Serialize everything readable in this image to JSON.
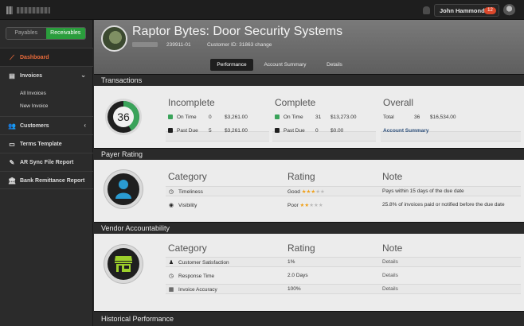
{
  "topbar": {
    "user_name": "John Hammond",
    "notification_count": "12"
  },
  "sidebar": {
    "toggle": {
      "payables": "Payables",
      "receivables": "Receivables"
    },
    "items": [
      {
        "label": "Dashboard",
        "icon": "chart-line-icon"
      },
      {
        "label": "Invoices",
        "icon": "invoice-icon"
      },
      {
        "label": "All Invoices"
      },
      {
        "label": "New Invoice"
      },
      {
        "label": "Customers",
        "icon": "users-icon"
      },
      {
        "label": "Terms Template",
        "icon": "document-icon"
      },
      {
        "label": "AR Sync File Report",
        "icon": "wrench-icon"
      },
      {
        "label": "Bank Remittance Report",
        "icon": "bank-icon"
      }
    ]
  },
  "header": {
    "title": "Raptor Bytes: Door Security Systems",
    "account_number": "239911-01",
    "customer_id_label": "Customer ID:",
    "customer_id": "31863",
    "change_link": "change"
  },
  "tabs": [
    "Performance",
    "Account Summary",
    "Details"
  ],
  "transactions": {
    "section_title": "Transactions",
    "circle_value": "36",
    "incomplete": {
      "heading": "Incomplete",
      "rows": [
        {
          "label": "On Time",
          "count": "0",
          "amount": "$3,261.00"
        },
        {
          "label": "Past Due",
          "count": "5",
          "amount": "$3,261.00"
        }
      ]
    },
    "complete": {
      "heading": "Complete",
      "rows": [
        {
          "label": "On Time",
          "count": "31",
          "amount": "$13,273.00"
        },
        {
          "label": "Past Due",
          "count": "0",
          "amount": "$0.00"
        }
      ]
    },
    "overall": {
      "heading": "Overall",
      "total_label": "Total",
      "total_count": "36",
      "total_amount": "$16,534.00",
      "link": "Account Summary"
    },
    "colors": {
      "on_time": "#3aa35a",
      "past_due": "#1f1f1f"
    }
  },
  "payer_rating": {
    "section_title": "Payer Rating",
    "headers": {
      "category": "Category",
      "rating": "Rating",
      "note": "Note"
    },
    "rows": [
      {
        "category": "Timeliness",
        "icon": "clock-icon",
        "rating": "Good",
        "stars": 3,
        "note": "Pays within 15 days of the due date"
      },
      {
        "category": "Visibility",
        "icon": "eye-icon",
        "rating": "Poor",
        "stars": 2,
        "note": "25.8% of invoices paid or notified before the due date"
      }
    ],
    "circle_color": "#2a9bd1"
  },
  "vendor_accountability": {
    "section_title": "Vendor Accountability",
    "headers": {
      "category": "Category",
      "rating": "Rating",
      "note": "Note"
    },
    "rows": [
      {
        "category": "Customer Satisfaction",
        "icon": "person-icon",
        "rating": "1%",
        "note": "Details"
      },
      {
        "category": "Response Time",
        "icon": "clock-icon",
        "rating": "2.0 Days",
        "note": "Details"
      },
      {
        "category": "Invoice Accuracy",
        "icon": "calculator-icon",
        "rating": "100%",
        "note": "Details"
      }
    ],
    "circle_color": "#9ccf2b"
  },
  "historical": {
    "section_title": "Historical Performance"
  }
}
